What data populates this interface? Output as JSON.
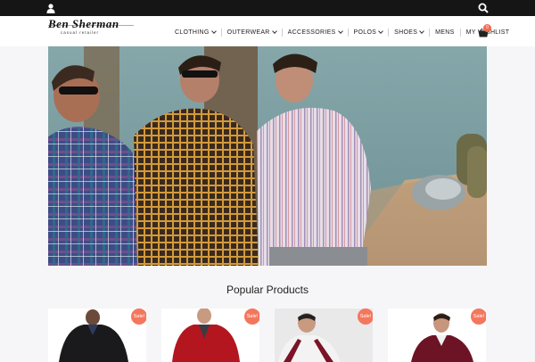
{
  "brand": {
    "name": "Ben Sherman",
    "tagline": "Casual Retailer"
  },
  "nav": {
    "items": [
      {
        "label": "CLOTHING",
        "dropdown": true
      },
      {
        "label": "OUTERWEAR",
        "dropdown": true
      },
      {
        "label": "ACCESSORIES",
        "dropdown": true
      },
      {
        "label": "POLOS",
        "dropdown": true
      },
      {
        "label": "SHOES",
        "dropdown": true
      },
      {
        "label": "MENS",
        "dropdown": false
      },
      {
        "label": "MY WISHLIST",
        "dropdown": false
      }
    ]
  },
  "cart": {
    "count": "0",
    "icon": "basket-icon"
  },
  "topbar": {
    "user_icon": "user-icon",
    "search_icon": "search-icon"
  },
  "section": {
    "title": "Popular Products"
  },
  "products": [
    {
      "badge": "Sale!"
    },
    {
      "badge": "Sale!"
    },
    {
      "badge": "Sale!"
    },
    {
      "badge": "Sale!"
    }
  ],
  "colors": {
    "topbar": "#151515",
    "accent": "#f26a4f",
    "background": "#f6f6f8"
  }
}
